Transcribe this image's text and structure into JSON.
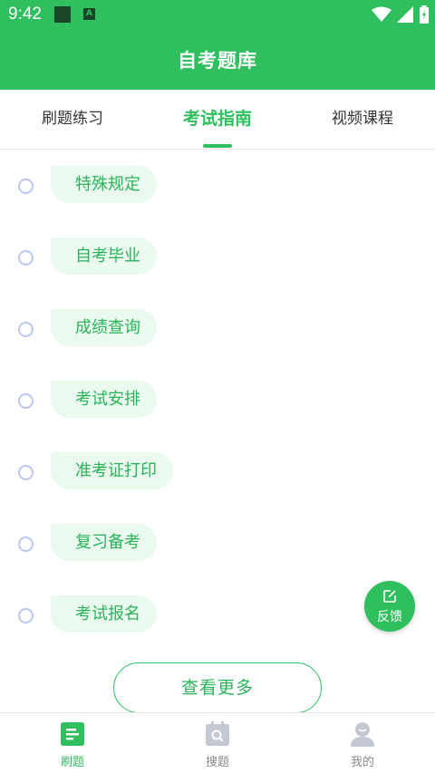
{
  "status_bar": {
    "time": "9:42",
    "notification_letter": "A"
  },
  "app_bar": {
    "title": "自考题库"
  },
  "tabs": [
    {
      "label": "刷题练习",
      "active": false
    },
    {
      "label": "考试指南",
      "active": true
    },
    {
      "label": "视频课程",
      "active": false
    }
  ],
  "guide_items": [
    {
      "label": "特殊规定"
    },
    {
      "label": "自考毕业"
    },
    {
      "label": "成绩查询"
    },
    {
      "label": "考试安排"
    },
    {
      "label": "准考证打印"
    },
    {
      "label": "复习备考"
    },
    {
      "label": "考试报名"
    }
  ],
  "more_button": {
    "label": "查看更多"
  },
  "feedback_button": {
    "label": "反馈"
  },
  "bottom_nav": [
    {
      "label": "刷题",
      "icon": "document-icon",
      "active": true
    },
    {
      "label": "搜题",
      "icon": "search-calendar-icon",
      "active": false
    },
    {
      "label": "我的",
      "icon": "user-icon",
      "active": false
    }
  ],
  "colors": {
    "primary": "#2fbf5e",
    "chip_bg": "#eafaef",
    "radio": "#b9c8ee"
  }
}
